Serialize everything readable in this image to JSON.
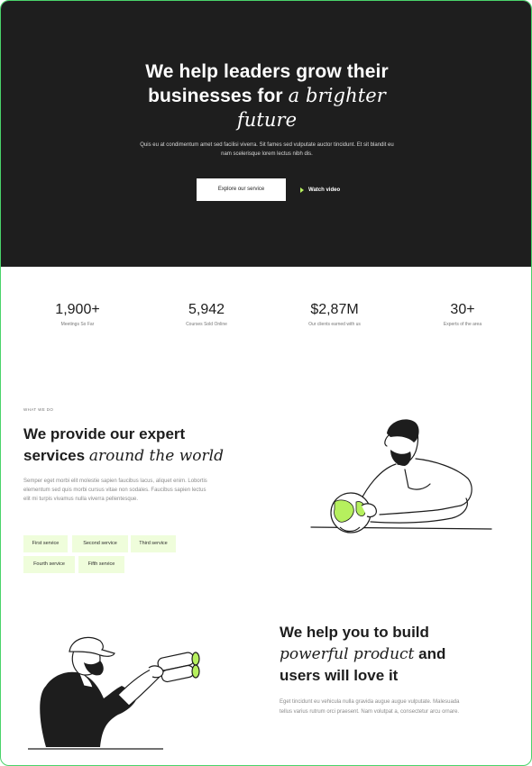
{
  "hero": {
    "title_line1": "We help leaders grow their",
    "title_line2_plain": "businesses for",
    "title_line2_italic": "a brighter",
    "title_line3_italic": "future",
    "description": "Quis eu at condimentum amet sed facilisi viverra. Sit fames sed vulputate auctor tincidunt. Et sit blandit eu nam scelerisque lorem lectus nibh dis.",
    "primary_button": "Explore our service",
    "watch_button": "Watch video"
  },
  "stats": [
    {
      "value": "1,900+",
      "label": "Meetings So Far"
    },
    {
      "value": "5,942",
      "label": "Courses Sold Online"
    },
    {
      "value": "$2,87M",
      "label": "Our clients earned with us"
    },
    {
      "value": "30+",
      "label": "Experts of the area"
    }
  ],
  "services": {
    "eyebrow": "WHAT WE DO",
    "title_line1": "We provide our expert",
    "title_line2_plain": "services",
    "title_line2_italic": "around the world",
    "description": "Semper eget morbi elit molestie sapien faucibus lacus, aliquet enim. Lobortis elementum sed quis morbi cursus vitae non sodales. Faucibus sapien lectus elit mi turpis vivamus nulla viverra pellentesque.",
    "chips": [
      "First service",
      "Second service",
      "Third service",
      "Fourth service",
      "Fifth service"
    ]
  },
  "product": {
    "title_line1": "We help you to build",
    "title_line2_italic": "powerful product",
    "title_line2_plain": "and",
    "title_line3": "users will love it",
    "description": "Eget tincidunt eu vehicula nulla gravida augue augue vulputate. Malesuada tellus varius rutrum orci praesent. Nam volutpat a, consectetur arcu ornare."
  },
  "colors": {
    "dark_bg": "#1e1e1e",
    "accent_green": "#b6f05e",
    "chip_bg": "#effddb",
    "frame_border": "#4ad36a"
  }
}
